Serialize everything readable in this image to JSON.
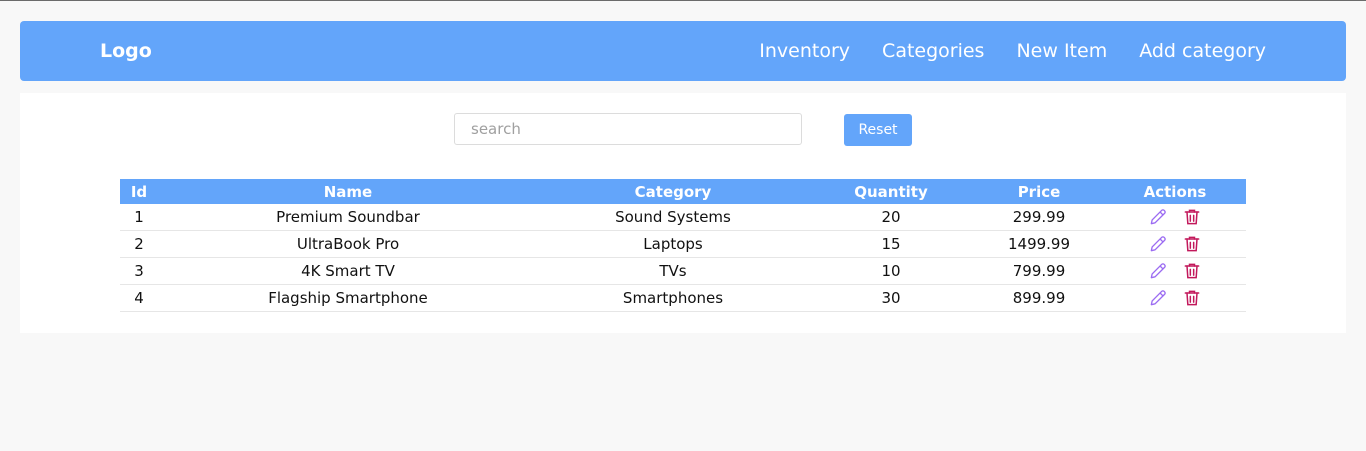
{
  "navbar": {
    "logo": "Logo",
    "links": [
      {
        "label": "Inventory"
      },
      {
        "label": "Categories"
      },
      {
        "label": "New Item"
      },
      {
        "label": "Add category"
      }
    ]
  },
  "search": {
    "placeholder": "search",
    "value": ""
  },
  "reset_label": "Reset",
  "table": {
    "columns": [
      "Id",
      "Name",
      "Category",
      "Quantity",
      "Price",
      "Actions"
    ],
    "rows": [
      {
        "id": "1",
        "name": "Premium Soundbar",
        "category": "Sound Systems",
        "quantity": "20",
        "price": "299.99"
      },
      {
        "id": "2",
        "name": "UltraBook Pro",
        "category": "Laptops",
        "quantity": "15",
        "price": "1499.99"
      },
      {
        "id": "3",
        "name": "4K Smart TV",
        "category": "TVs",
        "quantity": "10",
        "price": "799.99"
      },
      {
        "id": "4",
        "name": "Flagship Smartphone",
        "category": "Smartphones",
        "quantity": "30",
        "price": "899.99"
      }
    ],
    "row_actions": [
      "pencil-icon",
      "trash-icon"
    ]
  },
  "colors": {
    "accent": "#63a5fa",
    "edit_icon": "#9b6bf2",
    "delete_icon": "#c2185b",
    "background": "#f8f8f8"
  }
}
